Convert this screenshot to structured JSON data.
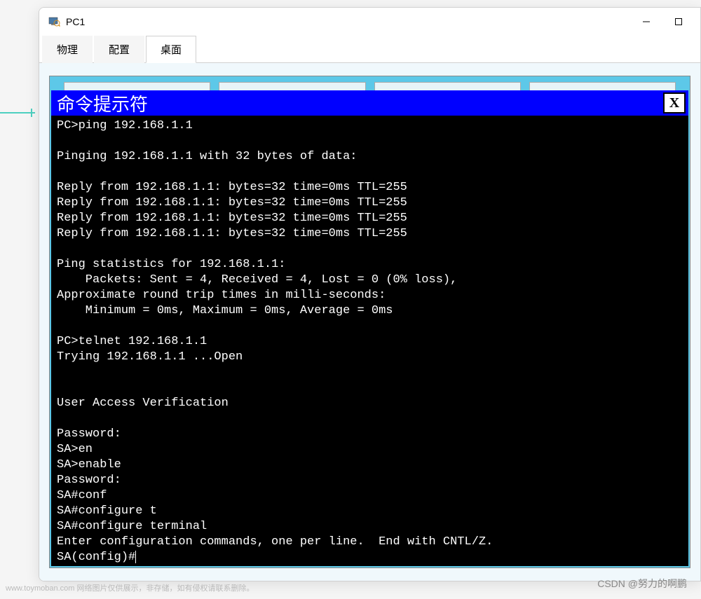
{
  "window": {
    "title": "PC1"
  },
  "tabs": {
    "physical": "物理",
    "config": "配置",
    "desktop": "桌面"
  },
  "cmd": {
    "title": "命令提示符",
    "close_label": "X",
    "lines": [
      "PC>ping 192.168.1.1",
      "",
      "Pinging 192.168.1.1 with 32 bytes of data:",
      "",
      "Reply from 192.168.1.1: bytes=32 time=0ms TTL=255",
      "Reply from 192.168.1.1: bytes=32 time=0ms TTL=255",
      "Reply from 192.168.1.1: bytes=32 time=0ms TTL=255",
      "Reply from 192.168.1.1: bytes=32 time=0ms TTL=255",
      "",
      "Ping statistics for 192.168.1.1:",
      "    Packets: Sent = 4, Received = 4, Lost = 0 (0% loss),",
      "Approximate round trip times in milli-seconds:",
      "    Minimum = 0ms, Maximum = 0ms, Average = 0ms",
      "",
      "PC>telnet 192.168.1.1",
      "Trying 192.168.1.1 ...Open",
      "",
      "",
      "User Access Verification",
      "",
      "Password: ",
      "SA>en",
      "SA>enable",
      "Password: ",
      "SA#conf",
      "SA#configure t",
      "SA#configure terminal",
      "Enter configuration commands, one per line.  End with CNTL/Z.",
      "SA(config)#"
    ]
  },
  "watermark": {
    "left": "www.toymoban.com 网络图片仅供展示，非存储，如有侵权请联系删除。",
    "right": "CSDN @努力的啊鹏"
  }
}
